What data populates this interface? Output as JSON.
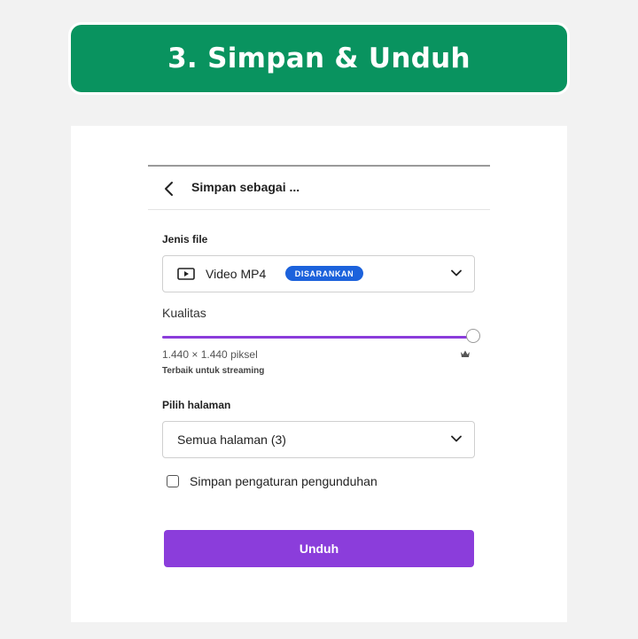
{
  "banner": {
    "title": "3. Simpan & Unduh"
  },
  "dialog": {
    "title": "Simpan sebagai ...",
    "file_type": {
      "label": "Jenis file",
      "value": "Video MP4",
      "badge": "DISARANKAN",
      "icon": "play-icon"
    },
    "quality": {
      "label": "Kualitas",
      "level_fraction": 1.0,
      "dimensions": "1.440 × 1.440 piksel",
      "note": "Terbaik untuk streaming",
      "premium_icon": "crown-icon"
    },
    "pages": {
      "label": "Pilih halaman",
      "value": "Semua halaman (3)"
    },
    "remember": {
      "label": "Simpan pengaturan pengunduhan",
      "checked": false
    },
    "download_button": "Unduh"
  },
  "colors": {
    "banner_green": "#09935f",
    "accent_purple": "#8b3ddb",
    "badge_blue": "#1c62dc"
  }
}
